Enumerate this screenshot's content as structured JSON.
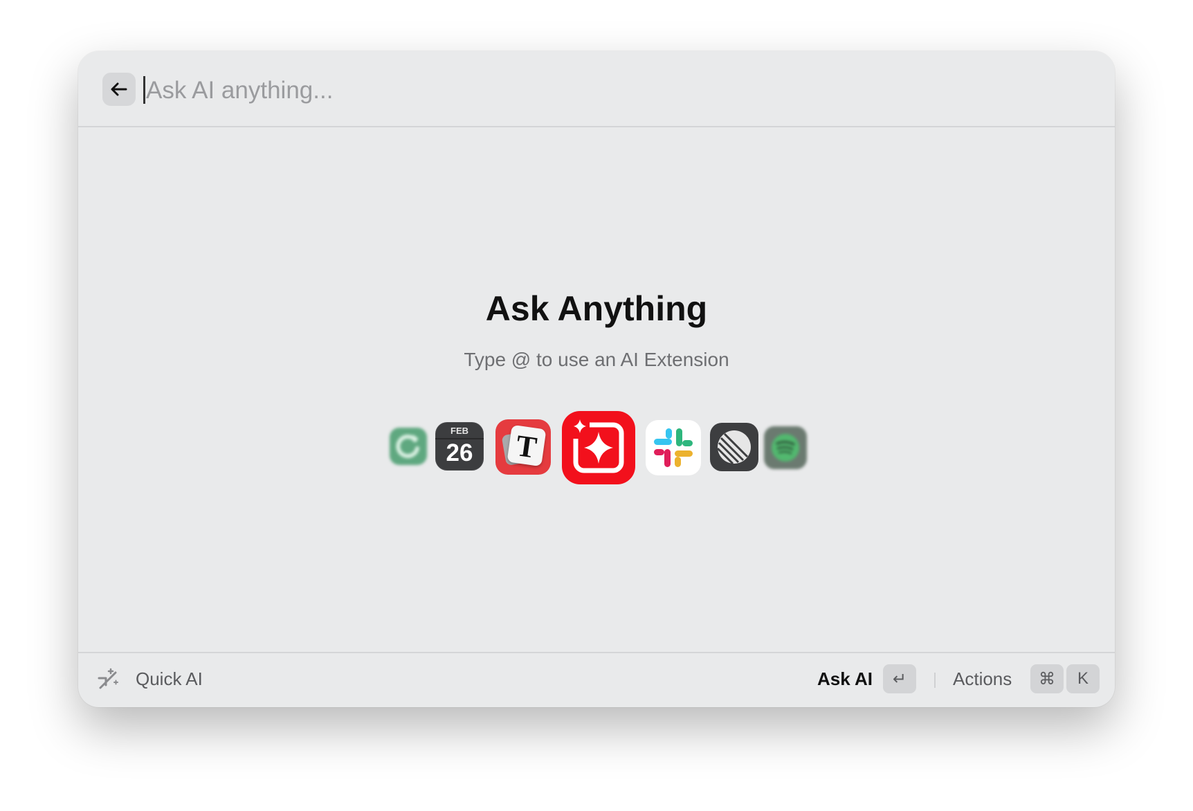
{
  "search": {
    "placeholder": "Ask AI anything...",
    "value": ""
  },
  "main": {
    "title": "Ask Anything",
    "subtitle": "Type @ to use an AI Extension"
  },
  "extension_icons": [
    {
      "name": "reminders-refresh-icon",
      "blurred": true
    },
    {
      "name": "calendar-icon",
      "month": "FEB",
      "day": "26"
    },
    {
      "name": "typora-icon",
      "glyph": "T"
    },
    {
      "name": "raycast-ai-icon",
      "featured": true
    },
    {
      "name": "slack-icon"
    },
    {
      "name": "linear-icon"
    },
    {
      "name": "spotify-icon",
      "blurred": true
    }
  ],
  "footer": {
    "left_label": "Quick AI",
    "left_icon": "quick-ai-icon",
    "primary_action": "Ask AI",
    "primary_key": "↵",
    "secondary_action": "Actions",
    "secondary_keys": [
      "⌘",
      "K"
    ]
  },
  "colors": {
    "window_bg": "#e9eaeb",
    "raycast_red": "#f0141e",
    "typora_red": "#e63b3b",
    "calendar_dark": "#3d3e40",
    "spotify_green": "#1db954"
  }
}
